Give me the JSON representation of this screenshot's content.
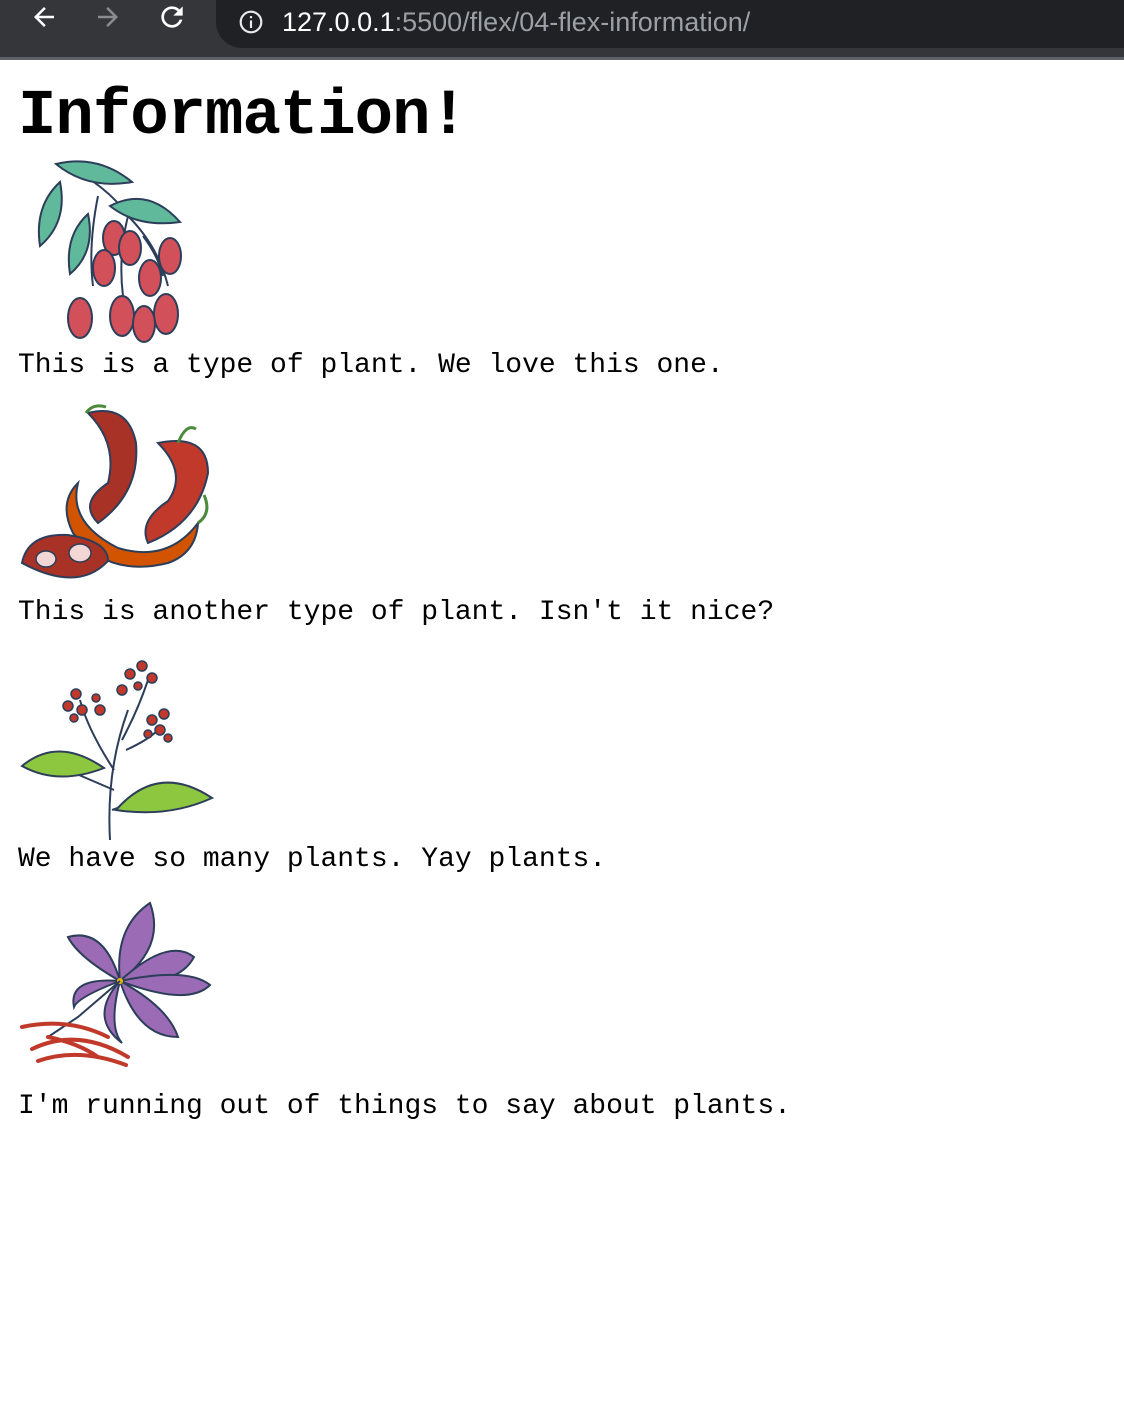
{
  "browser": {
    "url_host": "127.0.0.1",
    "url_rest": ":5500/flex/04-flex-information/"
  },
  "page": {
    "title": "Information!",
    "items": [
      {
        "icon": "goji-berry-branch-icon",
        "text": "This is a type of plant. We love this one."
      },
      {
        "icon": "chili-pepper-icon",
        "text": "This is another type of plant. Isn't it nice?"
      },
      {
        "icon": "berry-sprig-icon",
        "text": "We have so many plants. Yay plants."
      },
      {
        "icon": "saffron-flower-icon",
        "text": "I'm running out of things to say about plants."
      }
    ]
  },
  "colors": {
    "toolbar": "#35363a",
    "omnibox": "#202124",
    "berry_red": "#d2505a",
    "leaf_teal": "#5fb99a",
    "pepper_red": "#c0392b",
    "leaf_green": "#8dc63f",
    "petal_purple": "#9b6bb5",
    "outline": "#2c3e5a"
  }
}
